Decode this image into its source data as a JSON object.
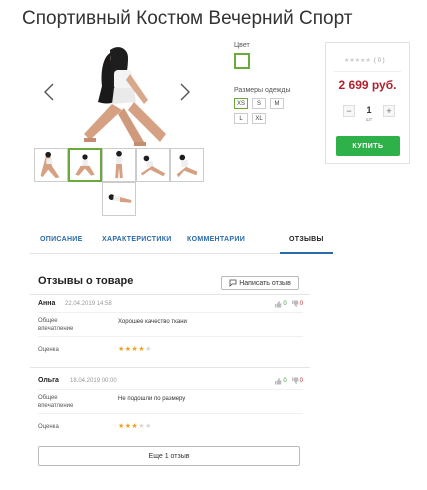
{
  "product": {
    "title": "Спортивный Костюм Вечерний Спорт"
  },
  "gallery": {
    "thumbnails": [
      {
        "label": "thumb-1"
      },
      {
        "label": "thumb-2"
      },
      {
        "label": "thumb-3"
      },
      {
        "label": "thumb-4"
      },
      {
        "label": "thumb-5"
      },
      {
        "label": "thumb-6"
      }
    ],
    "active_index": 1
  },
  "options": {
    "color_label": "Цвет",
    "sizes_label": "Размеры одежды",
    "sizes": [
      "XS",
      "S",
      "M",
      "L",
      "XL"
    ],
    "selected_size": "XS"
  },
  "buy": {
    "rating_stars": "★★★★★",
    "rating_count": "( 0 )",
    "price": "2 699 руб.",
    "qty_minus": "−",
    "qty_plus": "+",
    "qty_value": "1",
    "qty_unit": "шт",
    "buy_label": "КУПИТЬ"
  },
  "tabs": [
    {
      "label": "ОПИСАНИЕ"
    },
    {
      "label": "ХАРАКТЕРИСТИКИ"
    },
    {
      "label": "КОММЕНТАРИИ"
    },
    {
      "label": "ОТЗЫВЫ"
    }
  ],
  "reviews": {
    "title": "Отзывы о товаре",
    "write_label": "Написать отзыв",
    "general_label": "Общее впечатление",
    "rating_label": "Оценка",
    "items": [
      {
        "author": "Анна",
        "date": "22.04.2019 14:58",
        "likes": "0",
        "dislikes": "0",
        "impression": "Хорошее качество ткани",
        "rating": 4,
        "stars_on": "★★★★",
        "stars_off": "★"
      },
      {
        "author": "Ольга",
        "date": "18.04.2019 00:00",
        "likes": "0",
        "dislikes": "0",
        "impression": "Не подошли по размеру",
        "rating": 3,
        "stars_on": "★★★",
        "stars_off": "★★"
      }
    ],
    "more_label": "Еще 1 отзыв"
  },
  "colors": {
    "accent_green": "#2fb14a",
    "price_red": "#b3202d",
    "link_blue": "#2a6aa8",
    "star_gold": "#f0a020"
  }
}
